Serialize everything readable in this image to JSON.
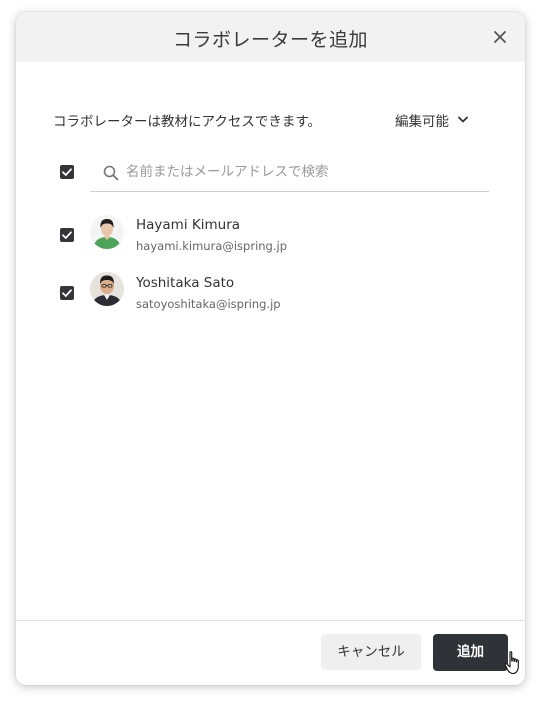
{
  "dialog": {
    "title": "コラボレーターを追加",
    "description": "コラボレーターは教材にアクセスできます。",
    "permission": {
      "selected": "編集可能",
      "icon": "chevron-down-icon"
    },
    "search": {
      "placeholder": "名前またはメールアドレスで検索",
      "value": ""
    },
    "users": [
      {
        "name": "Hayami Kimura",
        "email": "hayami.kimura@ispring.jp",
        "checked": true
      },
      {
        "name": "Yoshitaka Sato",
        "email": "satoyoshitaka@ispring.jp",
        "checked": true
      }
    ],
    "buttons": {
      "cancel": "キャンセル",
      "add": "追加"
    }
  },
  "colors": {
    "header_bg": "#f2f2f2",
    "primary_button": "#2f3236",
    "secondary_button": "#efefef",
    "checkbox": "#333538"
  }
}
